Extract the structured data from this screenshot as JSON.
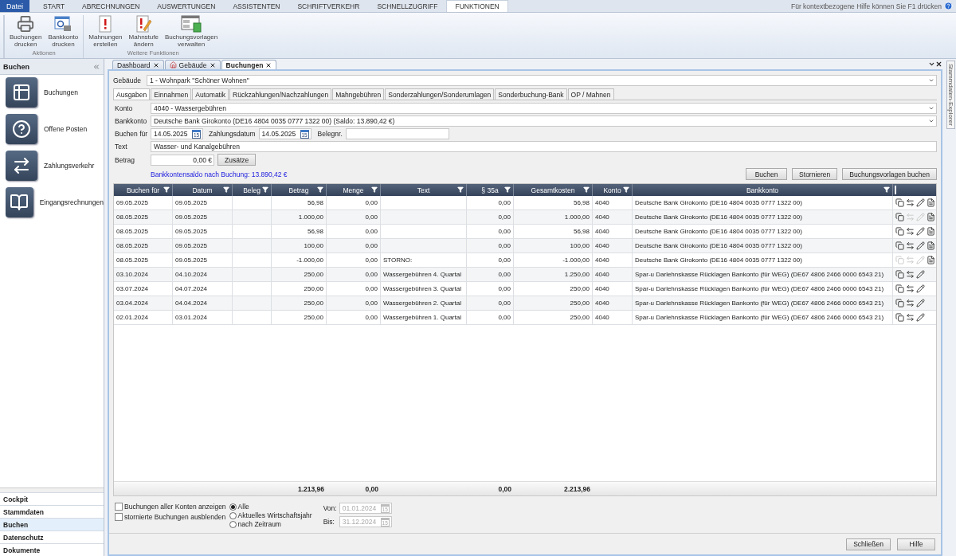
{
  "menu": {
    "file_button": "Datei",
    "tabs": [
      {
        "label": "START",
        "selected": false
      },
      {
        "label": "ABRECHNUNGEN",
        "selected": false
      },
      {
        "label": "AUSWERTUNGEN",
        "selected": false
      },
      {
        "label": "ASSISTENTEN",
        "selected": false
      },
      {
        "label": "SCHRIFTVERKEHR",
        "selected": false
      },
      {
        "label": "SCHNELLZUGRIFF",
        "selected": false
      },
      {
        "label": "FUNKTIONEN",
        "selected": true
      }
    ],
    "help_text": "Für kontextbezogene Hilfe können Sie F1 drücken"
  },
  "ribbon": {
    "groups": [
      {
        "label": "Aktionen",
        "buttons": [
          {
            "label": "Buchungen drucken",
            "kind": "printer"
          },
          {
            "label": "Bankkonto drucken",
            "kind": "bank-print"
          }
        ]
      },
      {
        "label": "Weitere Funktionen",
        "buttons": [
          {
            "label": "Mahnungen erstellen",
            "kind": "reminder"
          },
          {
            "label": "Mahnstufe ändern",
            "kind": "reminder-edit"
          },
          {
            "label": "Buchungsvorlagen verwalten",
            "kind": "template"
          }
        ]
      }
    ]
  },
  "sidebar": {
    "title": "Buchen",
    "items": [
      {
        "label": "Buchungen",
        "kind": "bookings"
      },
      {
        "label": "Offene Posten",
        "kind": "open-items"
      },
      {
        "label": "Zahlungsverkehr",
        "kind": "payments"
      },
      {
        "label": "Eingangsrechnungen",
        "kind": "invoices"
      }
    ],
    "nav": [
      {
        "label": "Cockpit",
        "selected": false
      },
      {
        "label": "Stammdaten",
        "selected": false
      },
      {
        "label": "Buchen",
        "selected": true
      },
      {
        "label": "Datenschutz",
        "selected": false
      },
      {
        "label": "Dokumente",
        "selected": false
      }
    ]
  },
  "doc_tabs": [
    {
      "label": "Dashboard",
      "selected": false
    },
    {
      "label": "Gebäude",
      "selected": false,
      "kind": "building"
    },
    {
      "label": "Buchungen",
      "selected": true
    }
  ],
  "side_panel": {
    "title": "Stammdaten-Explorer"
  },
  "building": {
    "label": "Gebäude",
    "value": "1 - Wohnpark \"Schöner Wohnen\""
  },
  "form_tabs": [
    {
      "label": "Ausgaben",
      "selected": true
    },
    {
      "label": "Einnahmen",
      "selected": false
    },
    {
      "label": "Automatik",
      "selected": false
    },
    {
      "label": "Rückzahlungen/Nachzahlungen",
      "selected": false
    },
    {
      "label": "Mahngebühren",
      "selected": false
    },
    {
      "label": "Sonderzahlungen/Sonderumlagen",
      "selected": false
    },
    {
      "label": "Sonderbuchung-Bank",
      "selected": false
    },
    {
      "label": "OP / Mahnen",
      "selected": false
    }
  ],
  "form": {
    "konto": {
      "label": "Konto",
      "value": "4040 - Wassergebühren"
    },
    "bankkonto": {
      "label": "Bankkonto",
      "value": "Deutsche Bank Girokonto (DE16 4804 0035 0777 1322 00) (Saldo: 13.890,42 €)"
    },
    "buchen_fuer": {
      "label": "Buchen für",
      "value": "14.05.2025",
      "calendar_day": "15"
    },
    "zahlungsdatum": {
      "label": "Zahlungsdatum",
      "value": "14.05.2025",
      "calendar_day": "15"
    },
    "belegnr": {
      "label": "Belegnr."
    },
    "text": {
      "label": "Text",
      "value": "Wasser- und Kanalgebühren"
    },
    "betrag": {
      "label": "Betrag",
      "value": "0,00 €"
    },
    "zusaetze_button": "Zusätze",
    "saldo_hint": "Bankkontensaldo nach Buchung: 13.890,42 €",
    "buttons": [
      "Buchen",
      "Stornieren",
      "Buchungsvorlagen buchen"
    ]
  },
  "table": {
    "columns": [
      {
        "label": "Buchen für"
      },
      {
        "label": "Datum"
      },
      {
        "label": "Beleg"
      },
      {
        "label": "Betrag",
        "numeric": true,
        "total": "1.213,96"
      },
      {
        "label": "Menge",
        "numeric": true,
        "total": "0,00"
      },
      {
        "label": "Text"
      },
      {
        "label": "§ 35a",
        "numeric": true,
        "total": "0,00"
      },
      {
        "label": "Gesamtkosten",
        "numeric": true,
        "total": "2.213,96"
      },
      {
        "label": "Konto"
      },
      {
        "label": "Bankkonto"
      }
    ],
    "rows": [
      {
        "cells": [
          "09.05.2025",
          "09.05.2025",
          null,
          "56,98",
          "0,00",
          null,
          "0,00",
          "56,98",
          "4040",
          "Deutsche Bank Girokonto (DE16 4804 0035 0777 1322 00)"
        ],
        "actions": [
          {
            "kind": "copy",
            "disabled": false
          },
          {
            "kind": "swap",
            "disabled": false
          },
          {
            "kind": "edit",
            "disabled": false
          },
          {
            "kind": "document",
            "disabled": false
          }
        ]
      },
      {
        "cells": [
          "08.05.2025",
          "09.05.2025",
          null,
          "1.000,00",
          "0,00",
          null,
          "0,00",
          "1.000,00",
          "4040",
          "Deutsche Bank Girokonto (DE16 4804 0035 0777 1322 00)"
        ],
        "actions": [
          {
            "kind": "copy",
            "disabled": false
          },
          {
            "kind": "swap",
            "disabled": true
          },
          {
            "kind": "edit",
            "disabled": true
          },
          {
            "kind": "document",
            "disabled": false
          }
        ]
      },
      {
        "cells": [
          "08.05.2025",
          "09.05.2025",
          null,
          "56,98",
          "0,00",
          null,
          "0,00",
          "56,98",
          "4040",
          "Deutsche Bank Girokonto (DE16 4804 0035 0777 1322 00)"
        ],
        "actions": [
          {
            "kind": "copy",
            "disabled": false
          },
          {
            "kind": "swap",
            "disabled": false
          },
          {
            "kind": "edit",
            "disabled": false
          },
          {
            "kind": "document",
            "disabled": false
          }
        ]
      },
      {
        "cells": [
          "08.05.2025",
          "09.05.2025",
          null,
          "100,00",
          "0,00",
          null,
          "0,00",
          "100,00",
          "4040",
          "Deutsche Bank Girokonto (DE16 4804 0035 0777 1322 00)"
        ],
        "actions": [
          {
            "kind": "copy",
            "disabled": false
          },
          {
            "kind": "swap",
            "disabled": false
          },
          {
            "kind": "edit",
            "disabled": false
          },
          {
            "kind": "document",
            "disabled": false
          }
        ]
      },
      {
        "cells": [
          "08.05.2025",
          "09.05.2025",
          null,
          "-1.000,00",
          "0,00",
          "STORNO:",
          "0,00",
          "-1.000,00",
          "4040",
          "Deutsche Bank Girokonto (DE16 4804 0035 0777 1322 00)"
        ],
        "actions": [
          {
            "kind": "copy",
            "disabled": true
          },
          {
            "kind": "swap",
            "disabled": true
          },
          {
            "kind": "edit",
            "disabled": true
          },
          {
            "kind": "document",
            "disabled": false
          }
        ]
      },
      {
        "cells": [
          "03.10.2024",
          "04.10.2024",
          null,
          "250,00",
          "0,00",
          "Wassergebühren 4. Quartal",
          "0,00",
          "1.250,00",
          "4040",
          "Spar-u Darlehnskasse Rücklagen Bankonto  (für WEG) (DE67 4806 2466 0000 6543 21)"
        ],
        "actions": [
          {
            "kind": "copy",
            "disabled": false
          },
          {
            "kind": "swap",
            "disabled": false
          },
          {
            "kind": "edit",
            "disabled": false
          }
        ]
      },
      {
        "cells": [
          "03.07.2024",
          "04.07.2024",
          null,
          "250,00",
          "0,00",
          "Wassergebühren 3. Quartal",
          "0,00",
          "250,00",
          "4040",
          "Spar-u Darlehnskasse Rücklagen Bankonto  (für WEG) (DE67 4806 2466 0000 6543 21)"
        ],
        "actions": [
          {
            "kind": "copy",
            "disabled": false
          },
          {
            "kind": "swap",
            "disabled": false
          },
          {
            "kind": "edit",
            "disabled": false
          }
        ]
      },
      {
        "cells": [
          "03.04.2024",
          "04.04.2024",
          null,
          "250,00",
          "0,00",
          "Wassergebühren 2. Quartal",
          "0,00",
          "250,00",
          "4040",
          "Spar-u Darlehnskasse Rücklagen Bankonto  (für WEG) (DE67 4806 2466 0000 6543 21)"
        ],
        "actions": [
          {
            "kind": "copy",
            "disabled": false
          },
          {
            "kind": "swap",
            "disabled": false
          },
          {
            "kind": "edit",
            "disabled": false
          }
        ]
      },
      {
        "cells": [
          "02.01.2024",
          "03.01.2024",
          null,
          "250,00",
          "0,00",
          "Wassergebühren 1. Quartal",
          "0,00",
          "250,00",
          "4040",
          "Spar-u Darlehnskasse Rücklagen Bankonto  (für WEG) (DE67 4806 2466 0000 6543 21)"
        ],
        "actions": [
          {
            "kind": "copy",
            "disabled": false
          },
          {
            "kind": "swap",
            "disabled": false
          },
          {
            "kind": "edit",
            "disabled": false
          }
        ]
      }
    ]
  },
  "options": {
    "checkboxes": [
      {
        "label": "Buchungen aller Konten anzeigen",
        "checked": false
      },
      {
        "label": "stornierte Buchungen ausblenden",
        "checked": false
      }
    ],
    "radios": [
      {
        "label": "Alle",
        "selected": true
      },
      {
        "label": "Aktuelles Wirtschaftsjahr",
        "selected": false
      },
      {
        "label": "nach Zeitraum",
        "selected": false
      }
    ],
    "range": [
      {
        "label": "Von:",
        "value": "01.01.2024",
        "calendar_day": "15",
        "disabled": true
      },
      {
        "label": "Bis:",
        "value": "31.12.2024",
        "calendar_day": "15",
        "disabled": true
      }
    ]
  },
  "footer_buttons": [
    "Schließen",
    "Hilfe"
  ]
}
